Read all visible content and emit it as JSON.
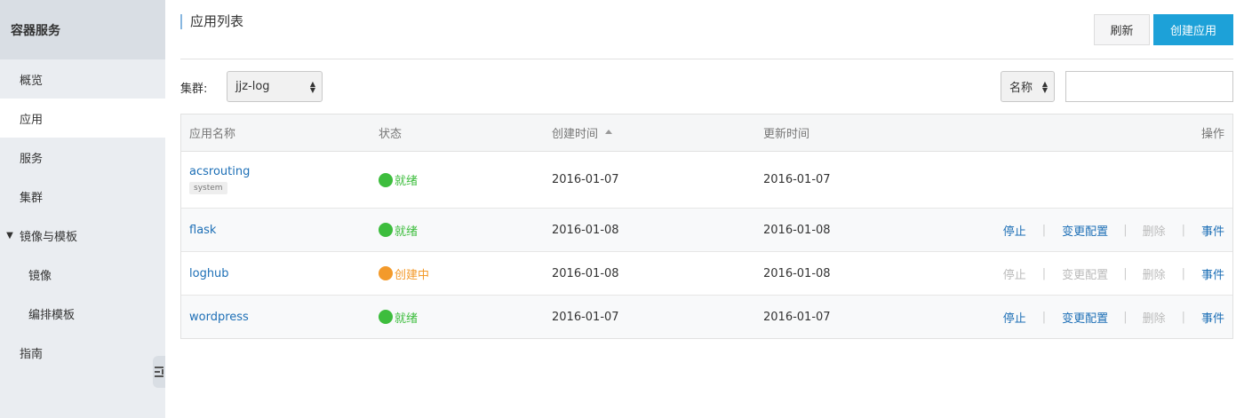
{
  "sidebar": {
    "header": "容器服务",
    "items": [
      {
        "label": "概览"
      },
      {
        "label": "应用"
      },
      {
        "label": "服务"
      },
      {
        "label": "集群"
      },
      {
        "label": "镜像与模板"
      },
      {
        "label": "镜像"
      },
      {
        "label": "编排模板"
      },
      {
        "label": "指南"
      }
    ]
  },
  "main": {
    "title": "应用列表",
    "refresh_label": "刷新",
    "create_label": "创建应用",
    "filter": {
      "cluster_label": "集群:",
      "cluster_value": "jjz-log",
      "search_field": "名称",
      "search_value": ""
    },
    "table": {
      "headers": [
        "应用名称",
        "状态",
        "创建时间",
        "更新时间",
        "操作"
      ],
      "rows": [
        {
          "name": "acsrouting",
          "tag": "system",
          "status": "就绪",
          "created": "2016-01-07",
          "updated": "2016-01-07"
        },
        {
          "name": "flask",
          "status": "就绪",
          "created": "2016-01-08",
          "updated": "2016-01-08",
          "ops": [
            "停止",
            "变更配置",
            "删除",
            "事件"
          ]
        },
        {
          "name": "loghub",
          "status": "创建中",
          "created": "2016-01-08",
          "updated": "2016-01-08",
          "ops": [
            "停止",
            "变更配置",
            "删除",
            "事件"
          ]
        },
        {
          "name": "wordpress",
          "status": "就绪",
          "created": "2016-01-07",
          "updated": "2016-01-07",
          "ops": [
            "停止",
            "变更配置",
            "删除",
            "事件"
          ]
        }
      ]
    }
  },
  "colors": {
    "accent": "#1da1d8",
    "link": "#1d6fb6",
    "status_ready": "#3dbd3d",
    "status_creating": "#f39a2b",
    "disabled": "#bbbbbb"
  }
}
